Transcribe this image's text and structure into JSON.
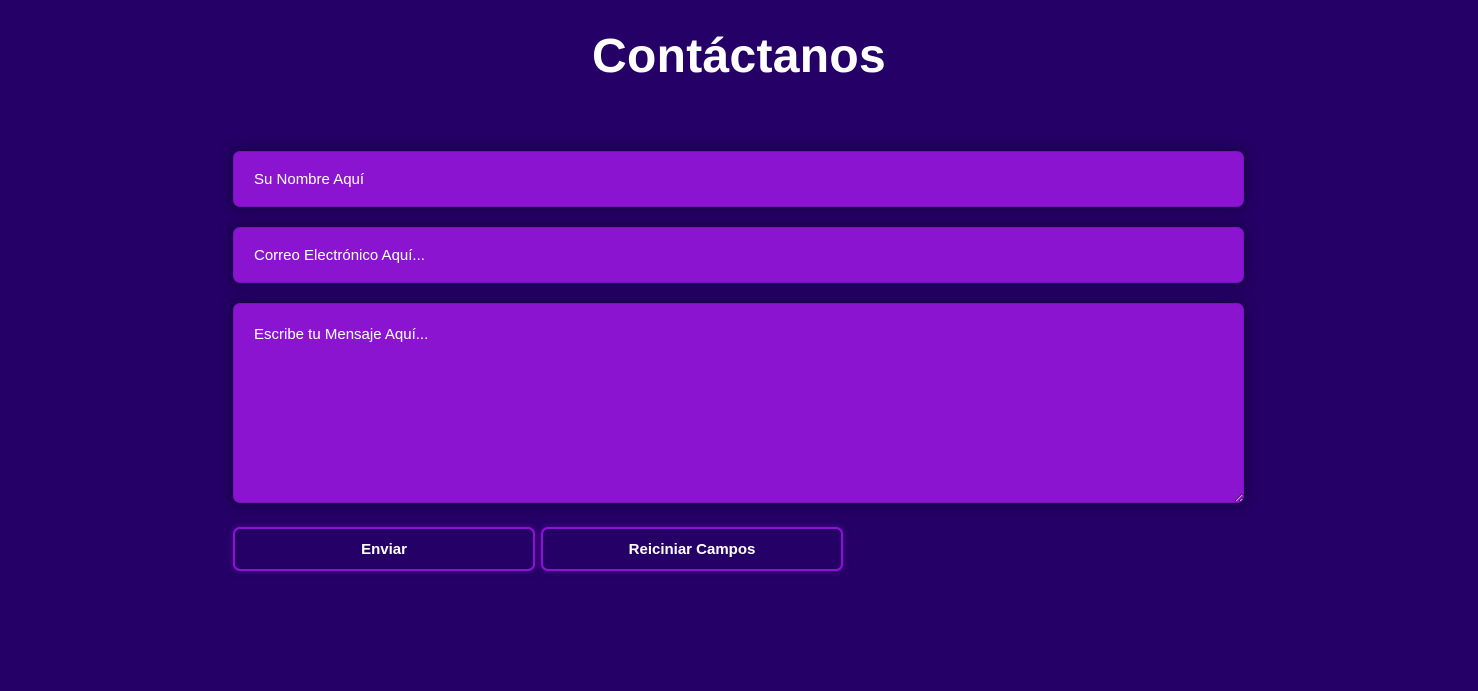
{
  "page": {
    "title": "Contáctanos"
  },
  "form": {
    "name_placeholder": "Su Nombre Aquí",
    "email_placeholder": "Correo Electrónico Aquí...",
    "message_placeholder": "Escribe tu Mensaje Aquí...",
    "submit_label": "Enviar",
    "reset_label": "Reiciniar Campos"
  },
  "colors": {
    "background": "#250066",
    "field_background": "#8a14cf",
    "button_border": "#8a14cf",
    "text": "#ffffff"
  }
}
